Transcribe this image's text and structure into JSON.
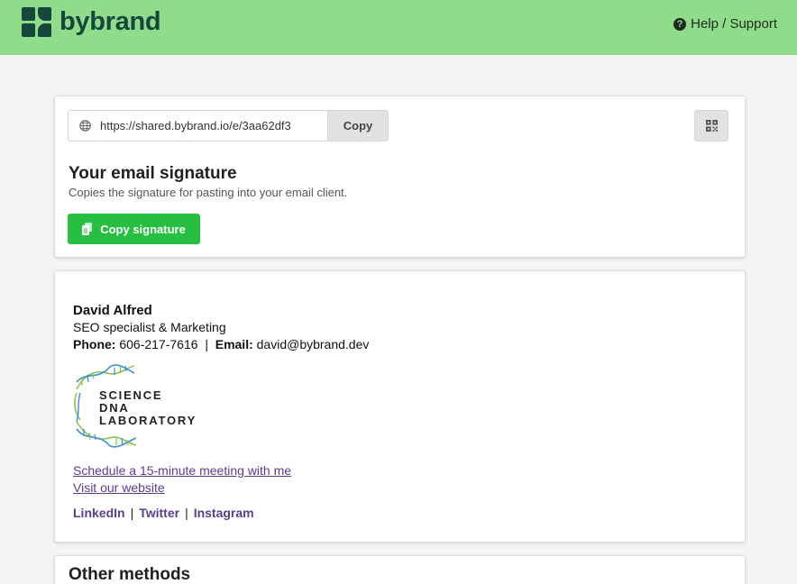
{
  "header": {
    "logo_text": "bybrand",
    "help_label": "Help / Support",
    "help_icon": "question-circle-icon"
  },
  "share": {
    "url": "https://shared.bybrand.io/e/3aa62df3",
    "copy_label": "Copy",
    "qr_icon": "qr-code-icon"
  },
  "email_signature": {
    "title": "Your email signature",
    "description": "Copies the signature for pasting into your email client.",
    "copy_button_label": "Copy signature"
  },
  "signature": {
    "name": "David Alfred",
    "role": "SEO specialist & Marketing",
    "phone_label": "Phone:",
    "phone": "606-217-7616",
    "separator": "|",
    "email_label": "Email:",
    "email": "david@bybrand.dev",
    "logo_line1": "SCIENCE",
    "logo_line2": "DNA LABORATORY",
    "meeting_link": "Schedule a 15-minute meeting with me",
    "website_link": "Visit our website",
    "social": [
      "LinkedIn",
      "Twitter",
      "Instagram"
    ]
  },
  "other_methods": {
    "title": "Other methods"
  },
  "colors": {
    "topbar": "#8fdc8a",
    "brand": "#15473d",
    "primary_button": "#27bf41",
    "link": "#5a3e8c"
  }
}
